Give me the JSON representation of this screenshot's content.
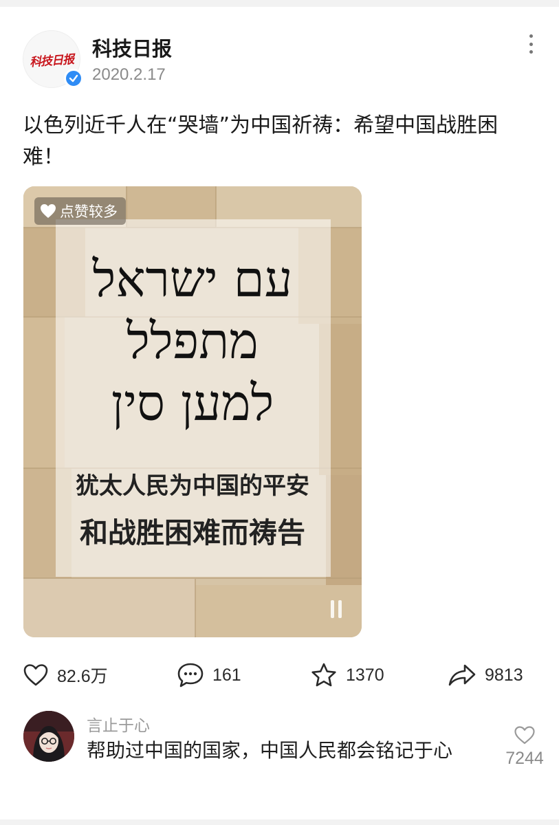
{
  "post": {
    "account_name": "科技日报",
    "avatar_logo_text": "科技日报",
    "date": "2020.2.17",
    "title": "以色列近千人在“哭墙”为中国祈祷：希望中国战胜困难！"
  },
  "media": {
    "badge": "点赞较多",
    "hebrew_lines": [
      "עם ישראל",
      "מתפלל",
      "למען סין"
    ],
    "chinese_line_1": "犹太人民为中国的平安",
    "chinese_line_2": "和战胜困难而祷告"
  },
  "actions": {
    "likes": "82.6万",
    "comments": "161",
    "favorites": "1370",
    "shares": "9813"
  },
  "comment": {
    "username": "言止于心",
    "text": "帮助过中国的国家，中国人民都会铭记于心",
    "like_count": "7244"
  },
  "colors": {
    "verified_blue": "#2f8cf5",
    "logo_red": "#c8161d",
    "muted_text": "#8a8a8a"
  },
  "icons": [
    "heart-icon",
    "comment-icon",
    "star-icon",
    "share-icon",
    "more-icon",
    "check-icon",
    "pause-icon"
  ]
}
